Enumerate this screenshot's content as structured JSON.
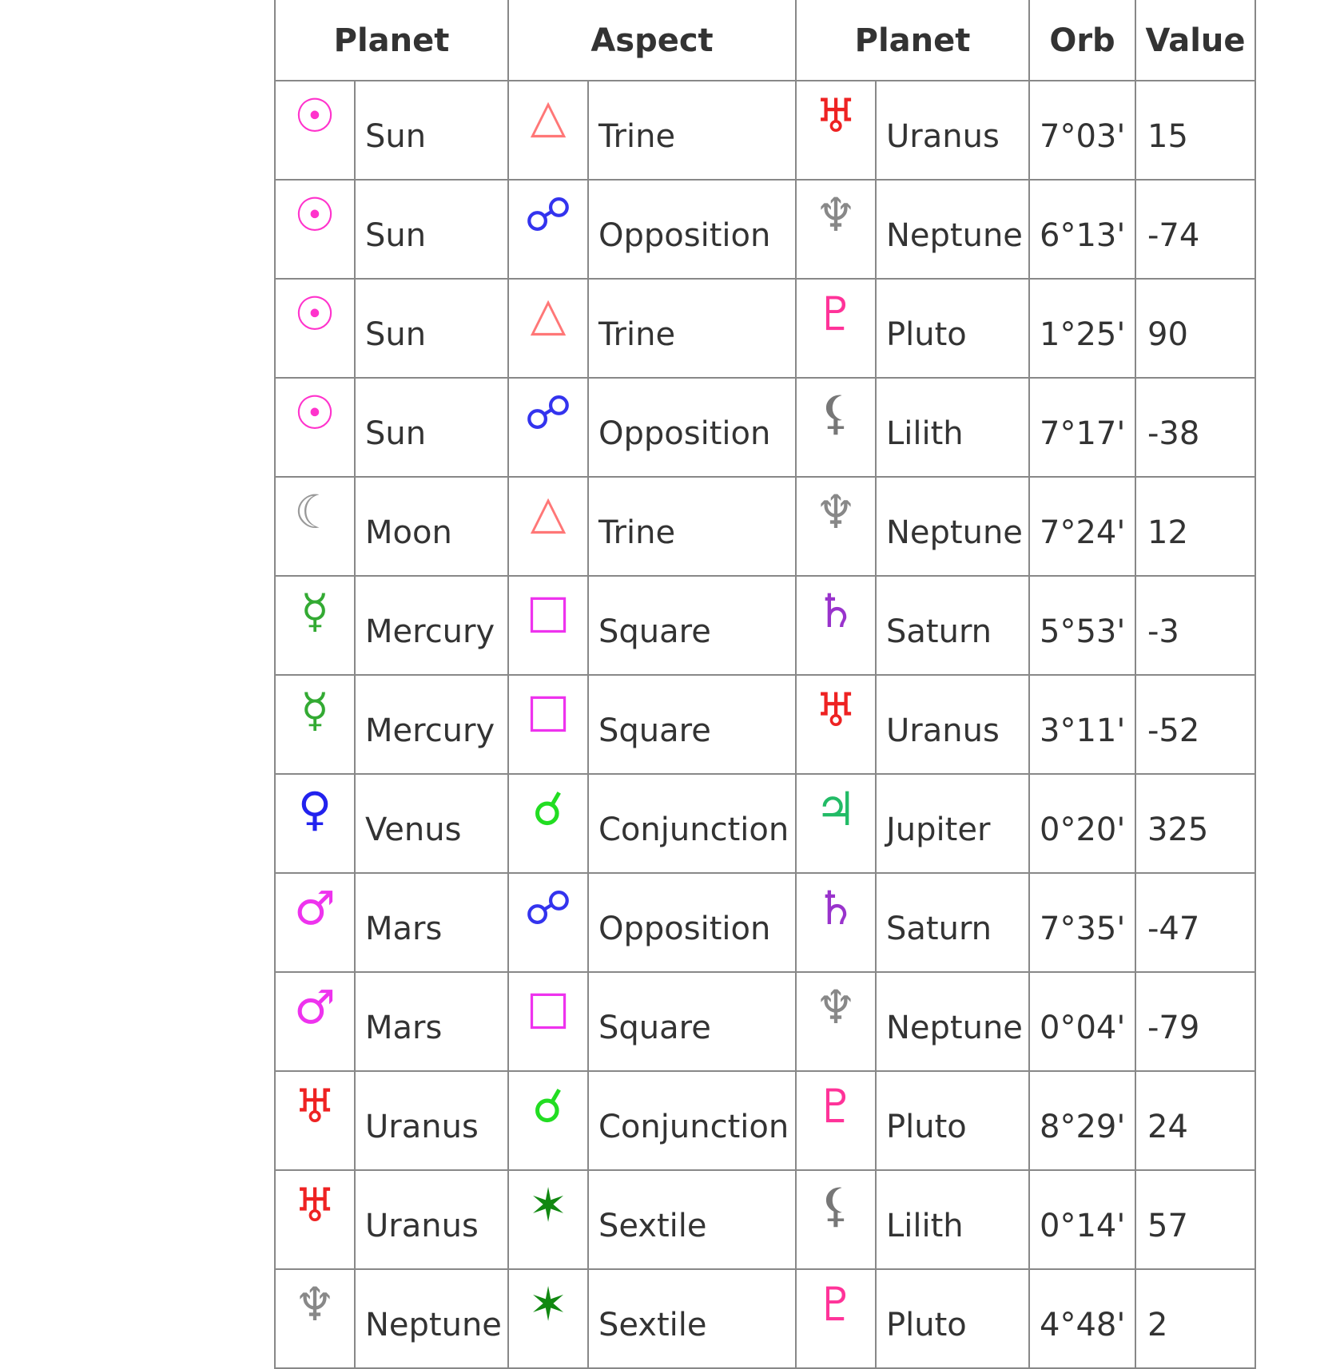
{
  "table": {
    "headers": [
      "Planet",
      "Aspect",
      "Planet",
      "Orb",
      "Value"
    ],
    "rows": [
      {
        "p1": "Sun",
        "p1_glyph": "☉",
        "p1_icon": "sun-icon",
        "p1_color": "#ff33cc",
        "aspect": "Trine",
        "a_glyph": "△",
        "a_icon": "trine-icon",
        "a_color": "#ff7777",
        "p2": "Uranus",
        "p2_glyph": "♅",
        "p2_icon": "uranus-icon",
        "p2_color": "#ee2222",
        "orb": "7°03'",
        "value": "15"
      },
      {
        "p1": "Sun",
        "p1_glyph": "☉",
        "p1_icon": "sun-icon",
        "p1_color": "#ff33cc",
        "aspect": "Opposition",
        "a_glyph": "☍",
        "a_icon": "opposition-icon",
        "a_color": "#3333ee",
        "p2": "Neptune",
        "p2_glyph": "♆",
        "p2_icon": "neptune-icon",
        "p2_color": "#888888",
        "orb": "6°13'",
        "value": "-74"
      },
      {
        "p1": "Sun",
        "p1_glyph": "☉",
        "p1_icon": "sun-icon",
        "p1_color": "#ff33cc",
        "aspect": "Trine",
        "a_glyph": "△",
        "a_icon": "trine-icon",
        "a_color": "#ff7777",
        "p2": "Pluto",
        "p2_glyph": "♇",
        "p2_icon": "pluto-icon",
        "p2_color": "#ff3399",
        "orb": "1°25'",
        "value": "90"
      },
      {
        "p1": "Sun",
        "p1_glyph": "☉",
        "p1_icon": "sun-icon",
        "p1_color": "#ff33cc",
        "aspect": "Opposition",
        "a_glyph": "☍",
        "a_icon": "opposition-icon",
        "a_color": "#3333ee",
        "p2": "Lilith",
        "p2_glyph": "⚸",
        "p2_icon": "lilith-icon",
        "p2_color": "#777777",
        "orb": "7°17'",
        "value": "-38"
      },
      {
        "p1": "Moon",
        "p1_glyph": "☾",
        "p1_icon": "moon-icon",
        "p1_color": "#999999",
        "aspect": "Trine",
        "a_glyph": "△",
        "a_icon": "trine-icon",
        "a_color": "#ff7777",
        "p2": "Neptune",
        "p2_glyph": "♆",
        "p2_icon": "neptune-icon",
        "p2_color": "#888888",
        "orb": "7°24'",
        "value": "12"
      },
      {
        "p1": "Mercury",
        "p1_glyph": "☿",
        "p1_icon": "mercury-icon",
        "p1_color": "#33aa33",
        "aspect": "Square",
        "a_glyph": "□",
        "a_icon": "square-icon",
        "a_color": "#ee33ee",
        "p2": "Saturn",
        "p2_glyph": "♄",
        "p2_icon": "saturn-icon",
        "p2_color": "#9933cc",
        "orb": "5°53'",
        "value": "-3"
      },
      {
        "p1": "Mercury",
        "p1_glyph": "☿",
        "p1_icon": "mercury-icon",
        "p1_color": "#33aa33",
        "aspect": "Square",
        "a_glyph": "□",
        "a_icon": "square-icon",
        "a_color": "#ee33ee",
        "p2": "Uranus",
        "p2_glyph": "♅",
        "p2_icon": "uranus-icon",
        "p2_color": "#ee2222",
        "orb": "3°11'",
        "value": "-52"
      },
      {
        "p1": "Venus",
        "p1_glyph": "♀",
        "p1_icon": "venus-icon",
        "p1_color": "#2222ee",
        "aspect": "Conjunction",
        "a_glyph": "☌",
        "a_icon": "conjunction-icon",
        "a_color": "#22dd22",
        "p2": "Jupiter",
        "p2_glyph": "♃",
        "p2_icon": "jupiter-icon",
        "p2_color": "#22bb66",
        "orb": "0°20'",
        "value": "325"
      },
      {
        "p1": "Mars",
        "p1_glyph": "♂",
        "p1_icon": "mars-icon",
        "p1_color": "#ee33ee",
        "aspect": "Opposition",
        "a_glyph": "☍",
        "a_icon": "opposition-icon",
        "a_color": "#3333ee",
        "p2": "Saturn",
        "p2_glyph": "♄",
        "p2_icon": "saturn-icon",
        "p2_color": "#9933cc",
        "orb": "7°35'",
        "value": "-47"
      },
      {
        "p1": "Mars",
        "p1_glyph": "♂",
        "p1_icon": "mars-icon",
        "p1_color": "#ee33ee",
        "aspect": "Square",
        "a_glyph": "□",
        "a_icon": "square-icon",
        "a_color": "#ee33ee",
        "p2": "Neptune",
        "p2_glyph": "♆",
        "p2_icon": "neptune-icon",
        "p2_color": "#888888",
        "orb": "0°04'",
        "value": "-79"
      },
      {
        "p1": "Uranus",
        "p1_glyph": "♅",
        "p1_icon": "uranus-icon",
        "p1_color": "#ee2222",
        "aspect": "Conjunction",
        "a_glyph": "☌",
        "a_icon": "conjunction-icon",
        "a_color": "#22dd22",
        "p2": "Pluto",
        "p2_glyph": "♇",
        "p2_icon": "pluto-icon",
        "p2_color": "#ff3399",
        "orb": "8°29'",
        "value": "24"
      },
      {
        "p1": "Uranus",
        "p1_glyph": "♅",
        "p1_icon": "uranus-icon",
        "p1_color": "#ee2222",
        "aspect": "Sextile",
        "a_glyph": "✶",
        "a_icon": "sextile-icon",
        "a_color": "#118811",
        "p2": "Lilith",
        "p2_glyph": "⚸",
        "p2_icon": "lilith-icon",
        "p2_color": "#777777",
        "orb": "0°14'",
        "value": "57"
      },
      {
        "p1": "Neptune",
        "p1_glyph": "♆",
        "p1_icon": "neptune-icon",
        "p1_color": "#888888",
        "aspect": "Sextile",
        "a_glyph": "✶",
        "a_icon": "sextile-icon",
        "a_color": "#118811",
        "p2": "Pluto",
        "p2_glyph": "♇",
        "p2_icon": "pluto-icon",
        "p2_color": "#ff3399",
        "orb": "4°48'",
        "value": "2"
      }
    ]
  }
}
